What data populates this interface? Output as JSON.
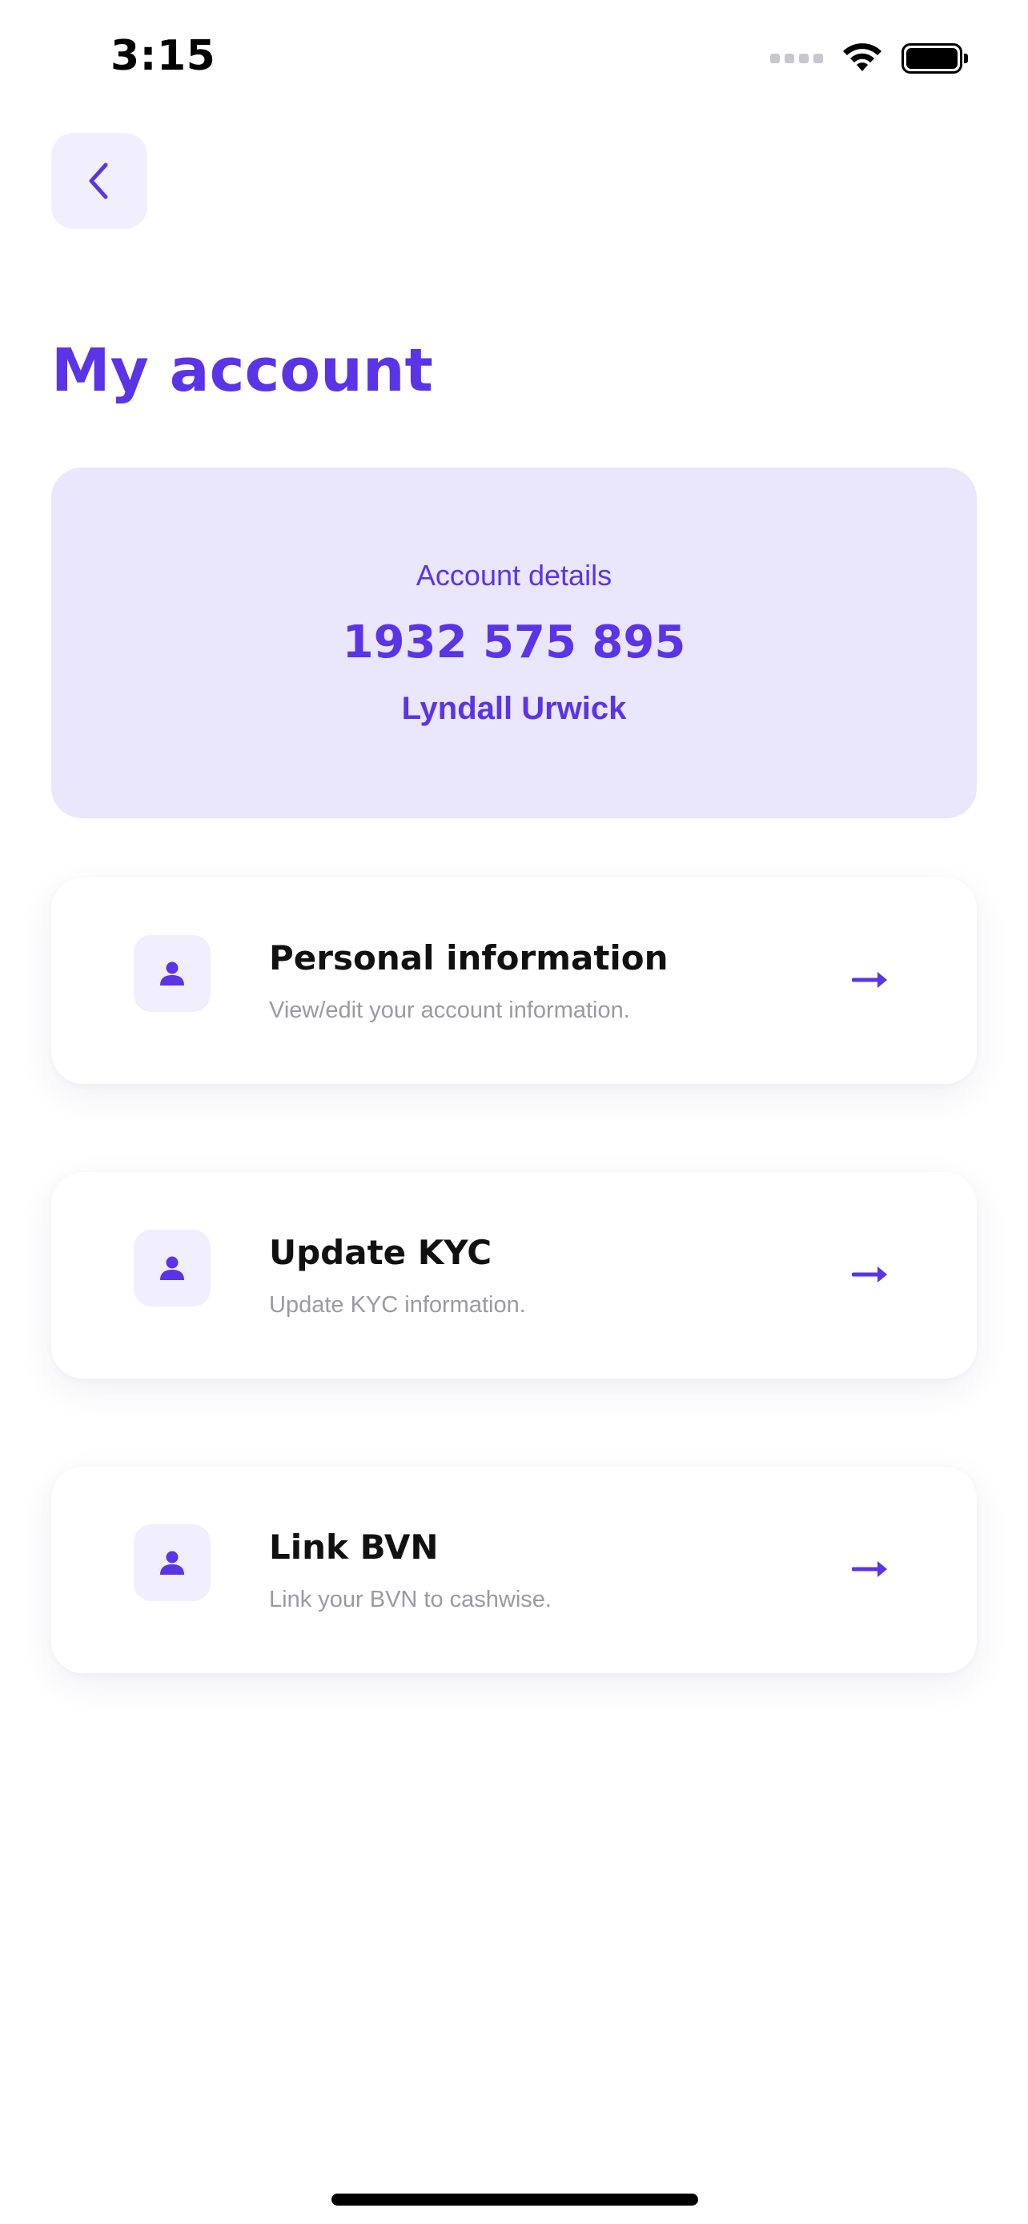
{
  "status_bar": {
    "time": "3:15"
  },
  "header": {
    "back_icon": "chevron-left-icon",
    "title": "My account"
  },
  "account_card": {
    "label": "Account details",
    "number": "1932 575 895",
    "name": "Lyndall Urwick"
  },
  "menu": [
    {
      "icon": "person-icon",
      "title": "Personal information",
      "subtitle": "View/edit your account information."
    },
    {
      "icon": "person-icon",
      "title": "Update KYC",
      "subtitle": "Update KYC information."
    },
    {
      "icon": "person-icon",
      "title": "Link BVN",
      "subtitle": "Link your BVN to cashwise."
    }
  ],
  "colors": {
    "accent": "#5a34e6",
    "accent_light": "#eae6fc",
    "icon_bg": "#f1eefd",
    "muted_text": "#9a9aa0"
  }
}
